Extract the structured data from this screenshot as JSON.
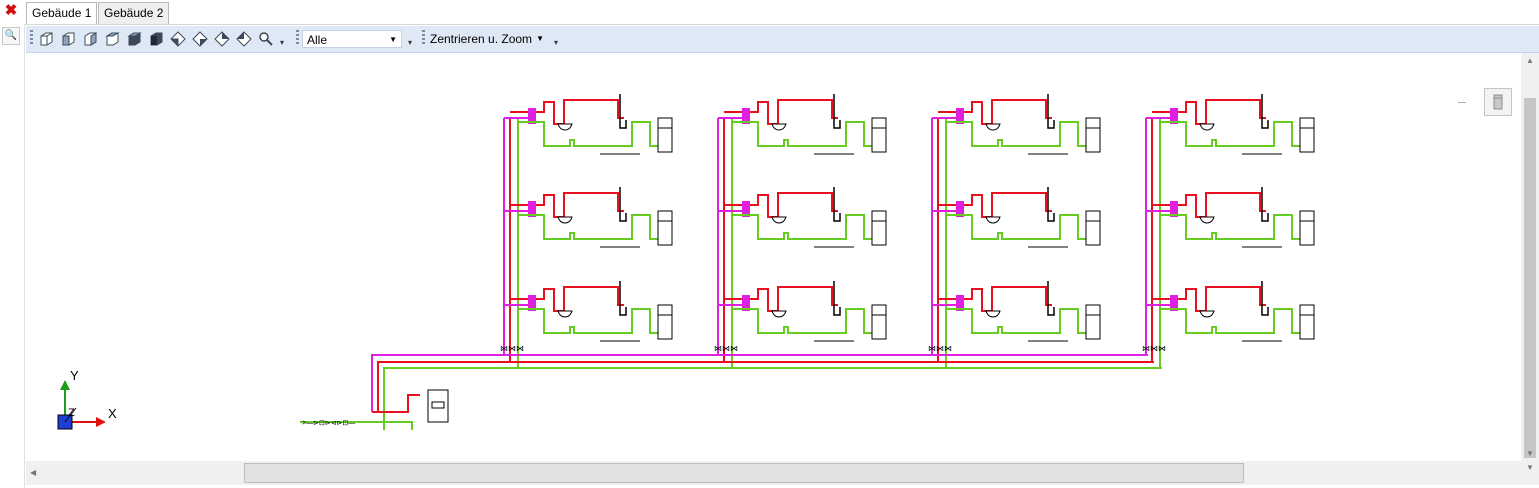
{
  "tabs": [
    {
      "label": "Gebäude 1",
      "active": true
    },
    {
      "label": "Gebäude 2",
      "active": false
    }
  ],
  "toolbar": {
    "view_buttons": [
      "view-back-icon",
      "view-front-icon",
      "view-left-icon",
      "view-right-icon",
      "view-top-icon",
      "view-bottom-icon",
      "iso-sw-icon",
      "iso-se-icon",
      "iso-ne-icon",
      "iso-nw-icon",
      "zoom-search-icon"
    ],
    "filter_value": "Alle",
    "zoom_label": "Zentrieren u. Zoom"
  },
  "axes": {
    "y_label": "Y",
    "z_label": "Z",
    "x_label": "X"
  },
  "colors": {
    "hot_water": "#e8101e",
    "circulation": "#e020e0",
    "cold_water": "#66cc22",
    "toolbar_bg": "#dfe9f5",
    "close": "#d01010"
  }
}
